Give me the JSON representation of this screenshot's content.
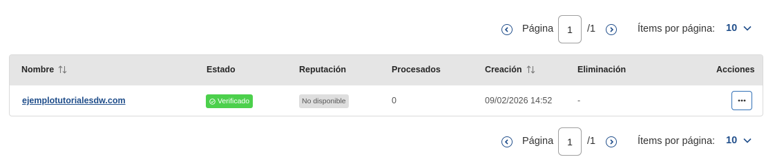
{
  "pagination": {
    "page_label": "Página",
    "current_page": "1",
    "total_pages": "/1",
    "items_per_page_label": "Ítems por página:",
    "items_per_page": "10"
  },
  "table": {
    "columns": {
      "name": "Nombre",
      "status": "Estado",
      "reputation": "Reputación",
      "processed": "Procesados",
      "created": "Creación",
      "deletion": "Eliminación",
      "actions": "Acciones"
    },
    "rows": [
      {
        "name": "ejemplotutorialesdw.com",
        "status": "Verificado",
        "reputation": "No disponible",
        "processed": "0",
        "created": "09/02/2026 14:52",
        "deletion": "-"
      }
    ]
  },
  "colors": {
    "accent": "#1f4d8a",
    "verified_badge": "#4cd04c",
    "header_bg": "#e5e5e5"
  },
  "icons": {
    "prev": "chevron-left-circle-icon",
    "next": "chevron-right-circle-icon",
    "dropdown": "chevron-down-icon",
    "sort": "sort-arrows-icon",
    "verified": "check-circle-icon",
    "more": "more-horizontal-icon"
  }
}
